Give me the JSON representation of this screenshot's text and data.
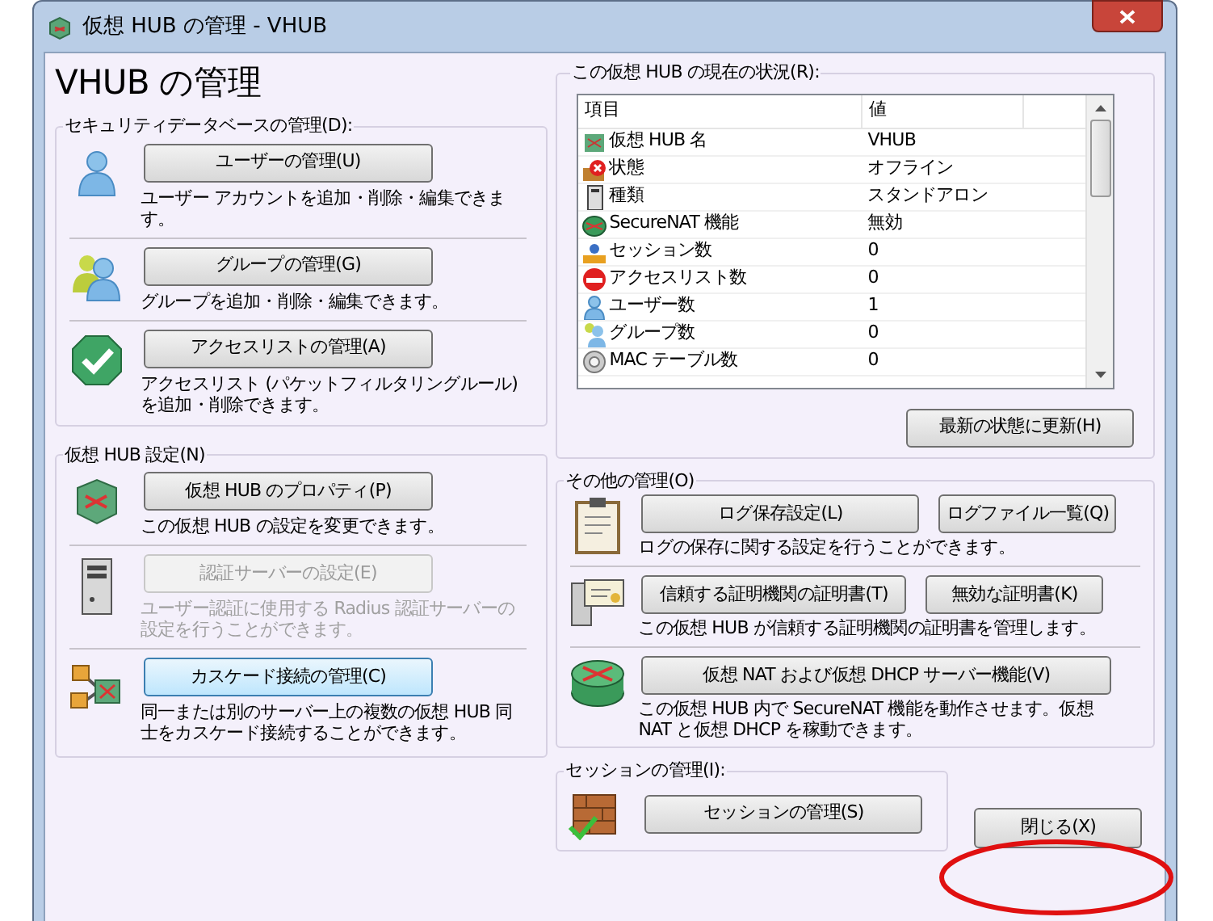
{
  "window": {
    "title": "仮想 HUB の管理 - VHUB"
  },
  "heading": "VHUB の管理",
  "security_group": {
    "title": "セキュリティデータベースの管理(D):",
    "items": [
      {
        "button": "ユーザーの管理(U)",
        "description": "ユーザー アカウントを追加・削除・編集できます。",
        "disabled": false,
        "focused": false
      },
      {
        "button": "グループの管理(G)",
        "description": "グループを追加・削除・編集できます。",
        "disabled": false,
        "focused": false
      },
      {
        "button": "アクセスリストの管理(A)",
        "description": "アクセスリスト (パケットフィルタリングルール) を追加・削除できます。",
        "disabled": false,
        "focused": false
      }
    ]
  },
  "hub_settings_group": {
    "title": "仮想 HUB 設定(N)",
    "items": [
      {
        "button": "仮想 HUB のプロパティ(P)",
        "description": "この仮想 HUB の設定を変更できます。",
        "disabled": false,
        "focused": false
      },
      {
        "button": "認証サーバーの設定(E)",
        "description": "ユーザー認証に使用する Radius 認証サーバーの設定を行うことができます。",
        "disabled": true,
        "focused": false
      },
      {
        "button": "カスケード接続の管理(C)",
        "description": "同一または別のサーバー上の複数の仮想 HUB 同士をカスケード接続することができます。",
        "disabled": false,
        "focused": true
      }
    ]
  },
  "status_group": {
    "title": "この仮想 HUB の現在の状況(R):",
    "table": {
      "columns": [
        "項目",
        "値"
      ],
      "rows": [
        {
          "item": "仮想 HUB 名",
          "value": "VHUB"
        },
        {
          "item": "状態",
          "value": "オフライン"
        },
        {
          "item": "種類",
          "value": "スタンドアロン"
        },
        {
          "item": "SecureNAT 機能",
          "value": "無効"
        },
        {
          "item": "セッション数",
          "value": "0"
        },
        {
          "item": "アクセスリスト数",
          "value": "0"
        },
        {
          "item": "ユーザー数",
          "value": "1"
        },
        {
          "item": "グループ数",
          "value": "0"
        },
        {
          "item": "MAC テーブル数",
          "value": "0"
        }
      ]
    },
    "refresh_button": "最新の状態に更新(H)"
  },
  "other_group": {
    "title": "その他の管理(O)",
    "rows": [
      {
        "buttons": [
          "ログ保存設定(L)",
          "ログファイル一覧(Q)"
        ],
        "description": "ログの保存に関する設定を行うことができます。"
      },
      {
        "buttons": [
          "信頼する証明機関の証明書(T)",
          "無効な証明書(K)"
        ],
        "description": "この仮想 HUB が信頼する証明機関の証明書を管理します。"
      },
      {
        "buttons": [
          "仮想 NAT および仮想 DHCP サーバー機能(V)"
        ],
        "description": "この仮想 HUB 内で SecureNAT 機能を動作させます。仮想 NAT と仮想 DHCP を稼動できます。"
      }
    ]
  },
  "session_group": {
    "title": "セッションの管理(I):",
    "button": "セッションの管理(S)"
  },
  "close_button": "閉じる(X)"
}
